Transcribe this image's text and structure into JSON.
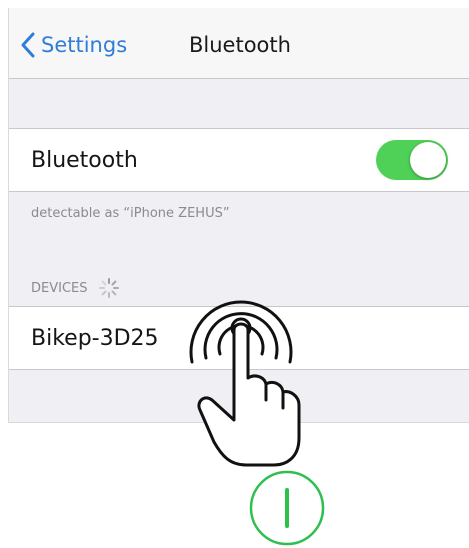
{
  "navbar": {
    "back_label": "Settings",
    "title": "Bluetooth"
  },
  "bluetooth_row": {
    "label": "Bluetooth",
    "toggle_state": "on",
    "toggle_color": "#4fd057"
  },
  "footnote": "detectable as “iPhone ZEHUS”",
  "devices": {
    "header": "DEVICES",
    "items": [
      {
        "name": "Bikep-3D25"
      }
    ]
  },
  "colors": {
    "accent": "#2f7ed6",
    "power_green": "#2fbf4f"
  },
  "icons": {
    "back": "chevron-left-icon",
    "loading": "spinner-icon",
    "gesture": "tap-hand-icon",
    "power": "power-button-icon"
  }
}
